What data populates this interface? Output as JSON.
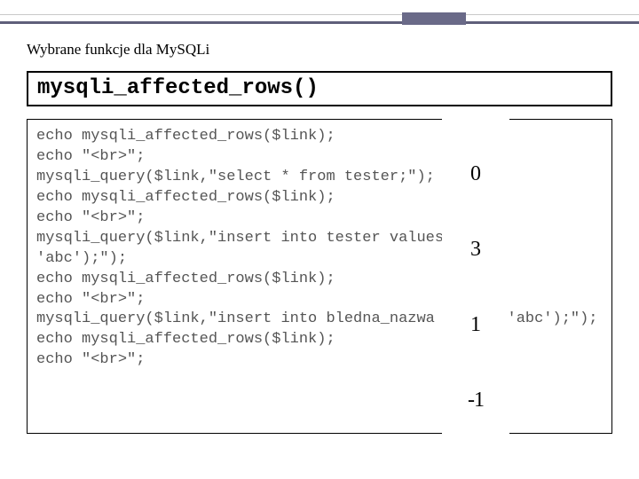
{
  "section_title": "Wybrane funkcje dla MySQLi",
  "func_name": "mysqli_affected_rows()",
  "code": "echo mysqli_affected_rows($link);\necho \"<br>\";\nmysqli_query($link,\"select * from tester;\");\necho mysqli_affected_rows($link);\necho \"<br>\";\nmysqli_query($link,\"insert into tester values (null, 'abc');\");\necho mysqli_affected_rows($link);\necho \"<br>\";\nmysqli_query($link,\"insert into bledna_nazwa (null, 'abc');\");\necho mysqli_affected_rows($link);\necho \"<br>\";",
  "output": [
    "0",
    "3",
    "1",
    "-1"
  ]
}
